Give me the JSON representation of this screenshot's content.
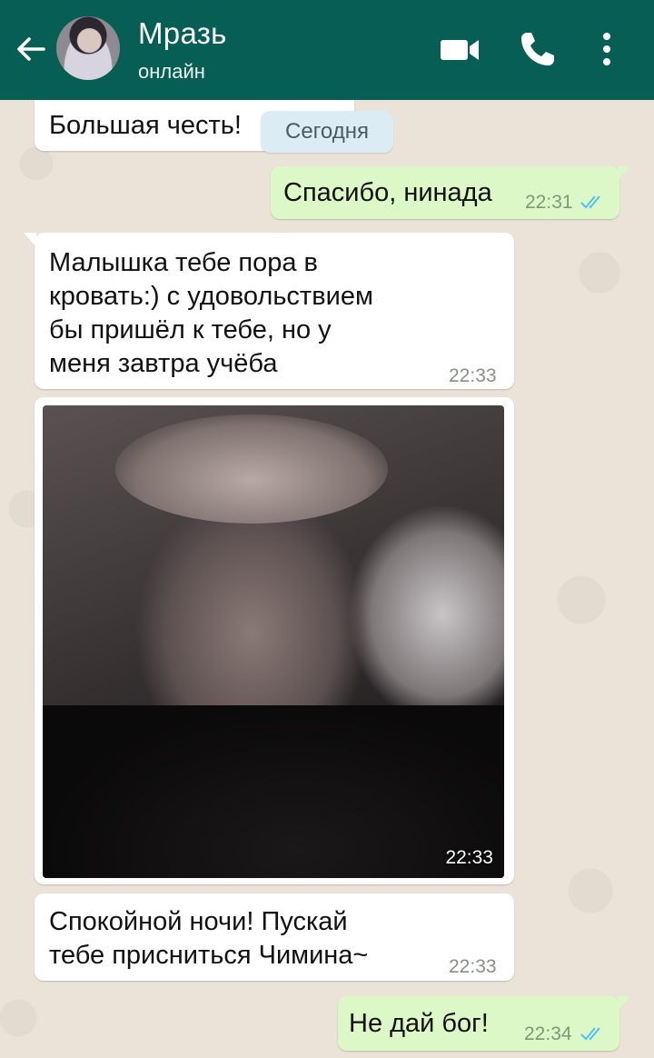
{
  "header": {
    "contact_name": "Мразь",
    "status": "онлайн",
    "colors": {
      "bar": "#075e54",
      "icons": "#ffffff"
    },
    "icons": [
      "back-arrow-icon",
      "video-call-icon",
      "phone-icon",
      "more-vert-icon"
    ]
  },
  "date_chip": "Сегодня",
  "messages": [
    {
      "direction": "in",
      "text": "Большая честь!",
      "time": ""
    },
    {
      "direction": "out",
      "text": "Спасибо, нинада",
      "time": "22:31",
      "status": "read"
    },
    {
      "direction": "in",
      "lines": [
        "Малышка тебе пора в",
        "кровать:) с удовольствием",
        "бы пришёл к тебе, но у",
        "меня завтра учёба"
      ],
      "time": "22:33"
    },
    {
      "direction": "in",
      "type": "photo",
      "time": "22:33"
    },
    {
      "direction": "in",
      "lines": [
        "Спокойной ночи! Пускай",
        "тебе присниться Чимина~"
      ],
      "time": "22:33"
    },
    {
      "direction": "out",
      "text": "Не дай бог!",
      "time": "22:34",
      "status": "read"
    }
  ],
  "colors": {
    "incoming": "#ffffff",
    "outgoing": "#dcf8c6",
    "read_ticks": "#4fc3f7",
    "date_chip": "#dbecf4"
  }
}
